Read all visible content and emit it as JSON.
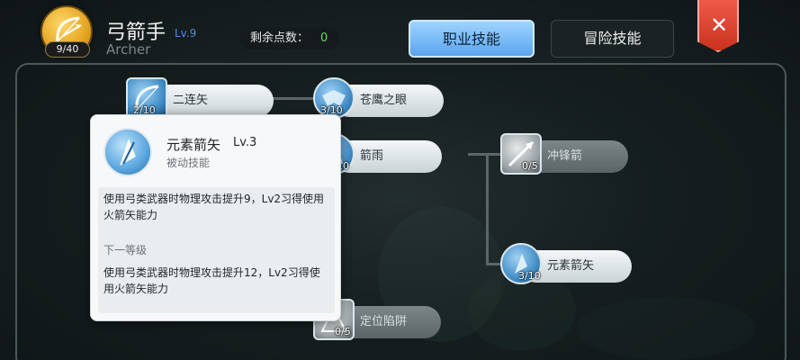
{
  "header": {
    "class_name": "弓箭手",
    "class_level": "Lv.9",
    "class_name_en": "Archer",
    "skill_points_badge": "9/40",
    "remaining_label": "剩余点数：",
    "remaining_value": "0",
    "tabs": [
      {
        "label": "职业技能",
        "active": true
      },
      {
        "label": "冒险技能",
        "active": false
      }
    ],
    "close_label": "✕"
  },
  "skills": [
    {
      "name": "二连矢",
      "level": "2/10",
      "locked": false,
      "icon": "bow-icon"
    },
    {
      "name": "苍鹰之眼",
      "level": "3/10",
      "locked": false,
      "icon": "eagle-eye-icon"
    },
    {
      "name": "箭雨",
      "level": "10",
      "locked": false,
      "icon": "arrow-rain-icon"
    },
    {
      "name": "冲锋箭",
      "level": "0/5",
      "locked": true,
      "icon": "charge-arrow-icon"
    },
    {
      "name": "元素箭矢",
      "level": "3/10",
      "locked": false,
      "icon": "element-arrow-icon"
    },
    {
      "name": "定位陷阱",
      "level": "0/5",
      "locked": true,
      "icon": "trap-icon"
    }
  ],
  "tooltip": {
    "name": "元素箭矢",
    "level": "Lv.3",
    "type": "被动技能",
    "description": "使用弓类武器时物理攻击提升9，Lv2习得使用火箭矢能力",
    "next_label": "下一等级",
    "next_description": "使用弓类武器时物理攻击提升12，Lv2习得使用火箭矢能力"
  },
  "colors": {
    "accent_blue": "#5aa4f0",
    "close_red": "#d8402c",
    "points_green": "#6fd46a",
    "emblem_gold": "#e3a422"
  }
}
